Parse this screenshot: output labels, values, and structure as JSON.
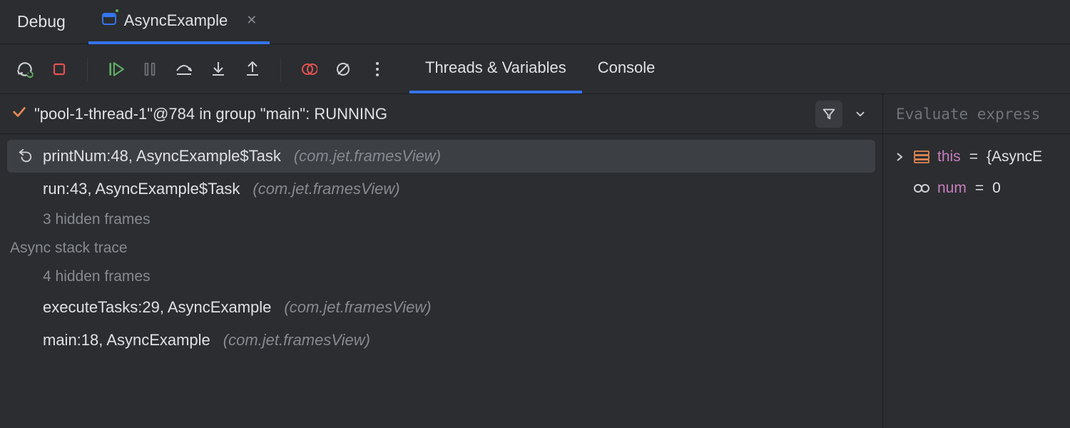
{
  "header": {
    "title": "Debug",
    "tab": {
      "label": "AsyncExample"
    }
  },
  "toolbar": {
    "tabs": {
      "threads": "Threads & Variables",
      "console": "Console"
    }
  },
  "thread": {
    "label": "\"pool-1-thread-1\"@784 in group \"main\": RUNNING"
  },
  "frames": {
    "top": [
      {
        "label": "printNum:48, AsyncExample$Task",
        "pkg": "(com.jet.framesView)",
        "selected": true,
        "hasDropIcon": true
      },
      {
        "label": "run:43, AsyncExample$Task",
        "pkg": "(com.jet.framesView)",
        "selected": false
      }
    ],
    "hidden_top": "3 hidden frames",
    "section_label": "Async stack trace",
    "hidden_bottom": "4 hidden frames",
    "bottom": [
      {
        "label": "executeTasks:29, AsyncExample",
        "pkg": "(com.jet.framesView)"
      },
      {
        "label": "main:18, AsyncExample",
        "pkg": "(com.jet.framesView)"
      }
    ]
  },
  "variables": {
    "eval_placeholder": "Evaluate express",
    "items": [
      {
        "name": "this",
        "value": "{AsyncE",
        "expandable": true,
        "icon": "object"
      },
      {
        "name": "num",
        "value": "0",
        "expandable": false,
        "icon": "watch"
      }
    ]
  }
}
